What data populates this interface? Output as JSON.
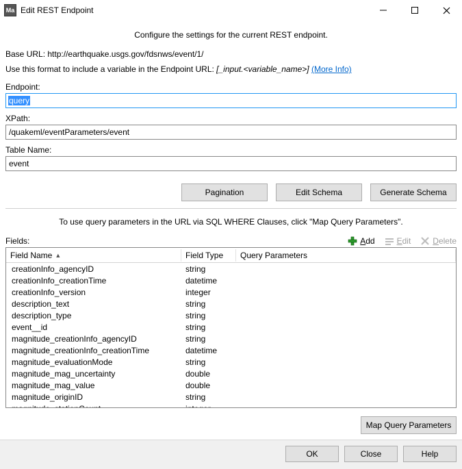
{
  "titlebar": {
    "app_icon_text": "Ma",
    "title": "Edit REST Endpoint"
  },
  "intro": "Configure the settings for the current REST endpoint.",
  "baseurl": {
    "label": "Base URL:",
    "value": "http://earthquake.usgs.gov/fdsnws/event/1/"
  },
  "format_hint": {
    "prefix": "Use this format to include a variable in the Endpoint URL:",
    "pattern": "[_input.<variable_name>]",
    "link_text": "(More Info)"
  },
  "endpoint": {
    "label": "Endpoint:",
    "value": "query"
  },
  "xpath": {
    "label": "XPath:",
    "value": "/quakeml/eventParameters/event"
  },
  "table_name": {
    "label": "Table Name:",
    "value": "event"
  },
  "schema_buttons": {
    "pagination": "Pagination",
    "edit_schema": "Edit Schema",
    "generate_schema": "Generate Schema"
  },
  "query_note": "To use query parameters in the URL via SQL WHERE Clauses, click \"Map Query Parameters\".",
  "fields_label": "Fields:",
  "toolbar": {
    "add": "Add",
    "edit": "Edit",
    "delete": "Delete"
  },
  "columns": {
    "name": "Field Name",
    "type": "Field Type",
    "qp": "Query Parameters"
  },
  "rows": [
    {
      "name": "creationInfo_agencyID",
      "type": "string"
    },
    {
      "name": "creationInfo_creationTime",
      "type": "datetime"
    },
    {
      "name": "creationInfo_version",
      "type": "integer"
    },
    {
      "name": "description_text",
      "type": "string"
    },
    {
      "name": "description_type",
      "type": "string"
    },
    {
      "name": "event__id",
      "type": "string"
    },
    {
      "name": "magnitude_creationInfo_agencyID",
      "type": "string"
    },
    {
      "name": "magnitude_creationInfo_creationTime",
      "type": "datetime"
    },
    {
      "name": "magnitude_evaluationMode",
      "type": "string"
    },
    {
      "name": "magnitude_mag_uncertainty",
      "type": "double"
    },
    {
      "name": "magnitude_mag_value",
      "type": "double"
    },
    {
      "name": "magnitude_originID",
      "type": "string"
    },
    {
      "name": "magnitude_stationCount",
      "type": "integer"
    }
  ],
  "map_query_btn": "Map Query Parameters",
  "footer": {
    "ok": "OK",
    "close": "Close",
    "help": "Help"
  }
}
